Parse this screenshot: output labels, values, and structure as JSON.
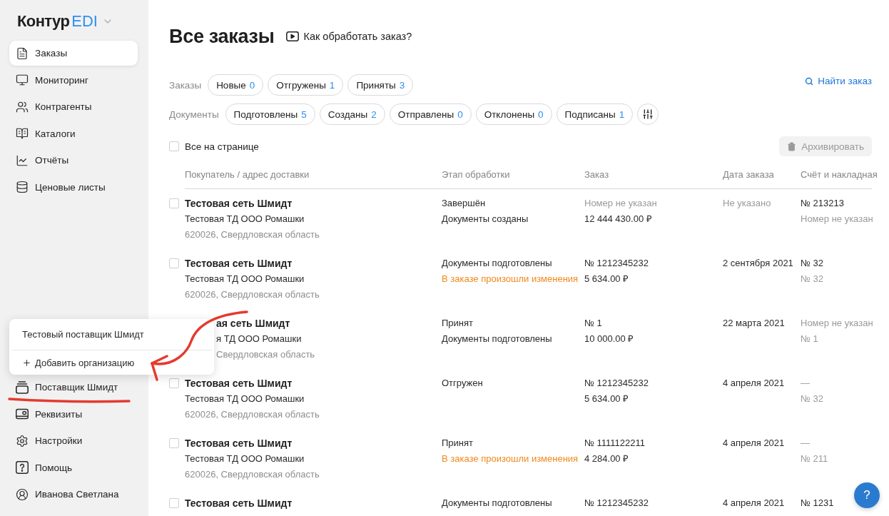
{
  "sidebar": {
    "logo": {
      "name": "Контур",
      "product": "EDI"
    },
    "items": [
      {
        "label": "Заказы",
        "selected": true
      },
      {
        "label": "Мониторинг",
        "selected": false
      },
      {
        "label": "Контрагенты",
        "selected": false
      },
      {
        "label": "Каталоги",
        "selected": false
      },
      {
        "label": "Отчёты",
        "selected": false
      },
      {
        "label": "Ценовые листы",
        "selected": false
      }
    ],
    "bottom_items": [
      {
        "label": "Поставщик Шмидт",
        "selected": false,
        "expanded": true,
        "menu": [
          {
            "kind": "organization",
            "label": "Тестовый поставщик Шмидт"
          },
          {
            "kind": "add",
            "label": "Добавить организацию"
          }
        ]
      },
      {
        "label": "Реквизиты",
        "selected": false
      },
      {
        "label": "Настройки",
        "selected": false
      },
      {
        "label": "Помощь",
        "selected": false
      },
      {
        "label": "Иванова Светлана",
        "selected": false
      }
    ]
  },
  "page": {
    "title": "Все заказы",
    "help_link": "Как обработать заказ?"
  },
  "filters": {
    "search_link": "Найти заказ",
    "groups": [
      {
        "label": "Заказы",
        "chips": [
          {
            "label": "Новые",
            "count": "0",
            "selected": false
          },
          {
            "label": "Отгружены",
            "count": "1",
            "selected": false
          },
          {
            "label": "Приняты",
            "count": "3",
            "selected": false
          }
        ]
      },
      {
        "label": "Документы",
        "chips": [
          {
            "label": "Подготовлены",
            "count": "5",
            "selected": false
          },
          {
            "label": "Созданы",
            "count": "2",
            "selected": false
          },
          {
            "label": "Отправлены",
            "count": "0",
            "selected": false
          },
          {
            "label": "Отклонены",
            "count": "0",
            "selected": false
          },
          {
            "label": "Подписаны",
            "count": "1",
            "selected": false
          }
        ]
      }
    ]
  },
  "toolbar": {
    "select_all": {
      "label": "Все на странице",
      "checked": false
    },
    "archive_button": {
      "label": "Архивировать",
      "disabled": true
    }
  },
  "table": {
    "columns": [
      "Покупатель / адрес доставки",
      "Этап обработки",
      "Заказ",
      "Дата заказа",
      "Счёт и накладная"
    ],
    "rows": [
      {
        "checked": false,
        "covered": false,
        "buyer": {
          "name": "Тестовая сеть Шмидт",
          "company": "Тестовая ТД ООО Ромашки",
          "address": "620026, Свердловская область"
        },
        "stage": [
          {
            "text": "Завершён",
            "kind": "normal"
          },
          {
            "text": "Документы созданы",
            "kind": "normal"
          }
        ],
        "order": [
          {
            "text": "Номер не указан",
            "kind": "muted"
          },
          {
            "text": "12 444 430.00 ₽",
            "kind": "normal"
          }
        ],
        "date": [
          {
            "text": "Не указано",
            "kind": "muted"
          }
        ],
        "documents": [
          {
            "text": "№ 213213",
            "kind": "normal"
          },
          {
            "text": "Номер не указан",
            "kind": "muted"
          }
        ]
      },
      {
        "checked": false,
        "covered": false,
        "buyer": {
          "name": "Тестовая сеть Шмидт",
          "company": "Тестовая ТД ООО Ромашки",
          "address": "620026, Свердловская область"
        },
        "stage": [
          {
            "text": "Документы подготовлены",
            "kind": "normal"
          },
          {
            "text": "В заказе произошли изменения",
            "kind": "warning"
          }
        ],
        "order": [
          {
            "text": "№ 1212345232",
            "kind": "normal"
          },
          {
            "text": "5 634.00 ₽",
            "kind": "normal"
          }
        ],
        "date": [
          {
            "text": "2 сентября 2021",
            "kind": "normal"
          }
        ],
        "documents": [
          {
            "text": "№ 32",
            "kind": "normal"
          },
          {
            "text": "№ 32",
            "kind": "muted"
          }
        ]
      },
      {
        "covered": true,
        "buyer": {
          "name": "ая сеть Шмидт",
          "company": "я ТД ООО Ромашки",
          "address": "Свердловская область"
        },
        "stage": [
          {
            "text": "Принят",
            "kind": "normal"
          },
          {
            "text": "Документы подготовлены",
            "kind": "normal"
          }
        ],
        "order": [
          {
            "text": "№ 1",
            "kind": "normal"
          },
          {
            "text": "10 000.00 ₽",
            "kind": "normal"
          }
        ],
        "date": [
          {
            "text": "22 марта 2021",
            "kind": "normal"
          }
        ],
        "documents": [
          {
            "text": "Номер не указан",
            "kind": "muted"
          },
          {
            "text": "№ 1",
            "kind": "muted"
          }
        ]
      },
      {
        "checked": false,
        "covered": false,
        "buyer": {
          "name": "Тестовая сеть Шмидт",
          "company": "Тестовая ТД ООО Ромашки",
          "address": "620026, Свердловская область"
        },
        "stage": [
          {
            "text": "Отгружен",
            "kind": "normal"
          }
        ],
        "order": [
          {
            "text": "№ 1212345232",
            "kind": "normal"
          },
          {
            "text": "5 634.00 ₽",
            "kind": "normal"
          }
        ],
        "date": [
          {
            "text": "4 апреля 2021",
            "kind": "normal"
          }
        ],
        "documents": [
          {
            "text": "—",
            "kind": "muted"
          },
          {
            "text": "№ 32",
            "kind": "muted"
          }
        ]
      },
      {
        "checked": false,
        "covered": false,
        "buyer": {
          "name": "Тестовая сеть Шмидт",
          "company": "Тестовая ТД ООО Ромашки",
          "address": "620026, Свердловская область"
        },
        "stage": [
          {
            "text": "Принят",
            "kind": "normal"
          },
          {
            "text": "В заказе произошли изменения",
            "kind": "warning"
          }
        ],
        "order": [
          {
            "text": "№ 1111122211",
            "kind": "normal"
          },
          {
            "text": "4 284.00 ₽",
            "kind": "normal"
          }
        ],
        "date": [
          {
            "text": "4 апреля 2021",
            "kind": "normal"
          }
        ],
        "documents": [
          {
            "text": "—",
            "kind": "muted"
          },
          {
            "text": "№ 211",
            "kind": "muted"
          }
        ]
      },
      {
        "checked": false,
        "covered": false,
        "buyer": {
          "name": "Тестовая сеть Шмидт"
        },
        "stage": [
          {
            "text": "Документы подготовлены",
            "kind": "normal"
          }
        ],
        "order": [
          {
            "text": "№ 1212345232",
            "kind": "normal"
          }
        ],
        "date": [
          {
            "text": "4 апреля 2021",
            "kind": "normal"
          }
        ],
        "documents": [
          {
            "text": "№ 1231",
            "kind": "normal"
          }
        ]
      }
    ]
  },
  "help_button": {
    "label": "?"
  }
}
